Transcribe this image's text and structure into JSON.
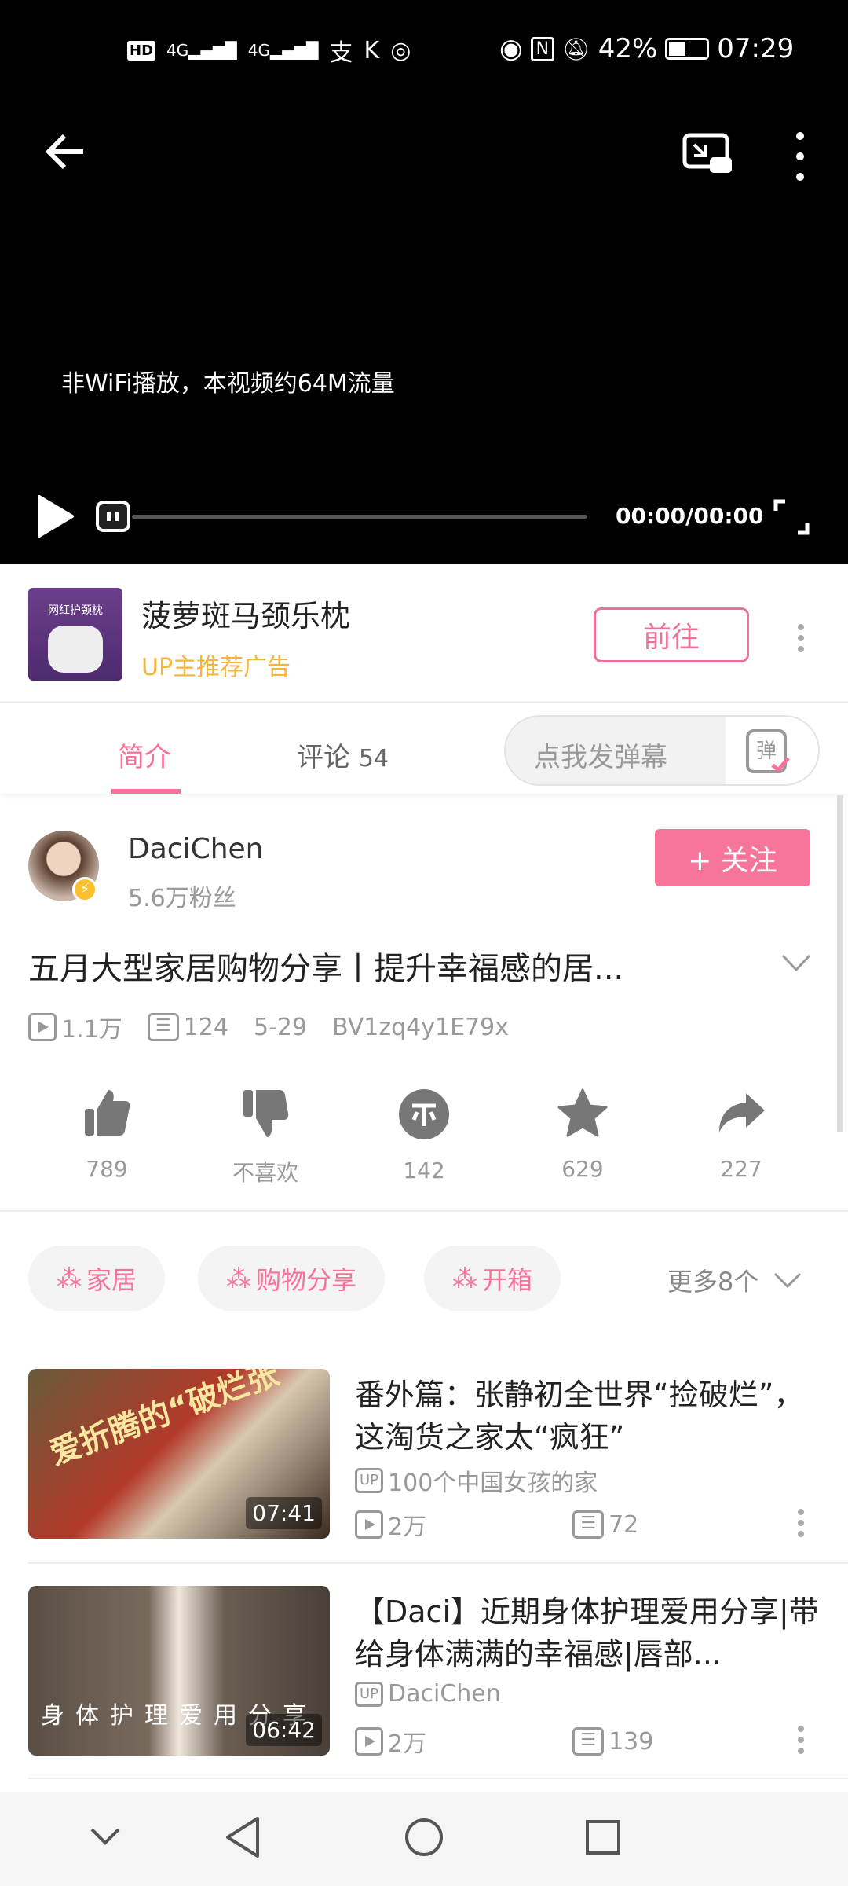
{
  "status_bar": {
    "left_icons": [
      "hd-icon",
      "4g-signal-icon",
      "4g-signal-icon",
      "alipay-icon",
      "k-icon",
      "location-icon"
    ],
    "battery": "42%",
    "time": "07:29",
    "battery_level": 0.42
  },
  "player": {
    "notice": "非WiFi播放，本视频约64M流量",
    "time": "00:00/00:00",
    "progress": 0
  },
  "ad": {
    "title": "菠萝斑马颈乐枕",
    "subtitle": "UP主推荐广告",
    "button": "前往",
    "thumb_text": "网红护颈枕"
  },
  "tabs": [
    {
      "label": "简介",
      "active": true
    },
    {
      "label": "评论",
      "count": "54"
    }
  ],
  "danmaku": {
    "placeholder": "点我发弹幕",
    "icon_text": "弹"
  },
  "uploader": {
    "name": "DaciChen",
    "fans": "5.6万粉丝",
    "follow": "+ 关注"
  },
  "video": {
    "title": "五月大型家居购物分享丨提升幸福感的居...",
    "views": "1.1万",
    "danmaku": "124",
    "date": "5-29",
    "bvid": "BV1zq4y1E79x"
  },
  "actions": [
    {
      "icon": "thumbs-up-icon",
      "label": "789"
    },
    {
      "icon": "thumbs-down-icon",
      "label": "不喜欢"
    },
    {
      "icon": "coin-icon",
      "label": "142"
    },
    {
      "icon": "star-icon",
      "label": "629"
    },
    {
      "icon": "share-icon",
      "label": "227"
    }
  ],
  "tags": [
    "家居",
    "购物分享",
    "开箱"
  ],
  "more_tags": "更多8个",
  "related": [
    {
      "title": "番外篇：张静初全世界“捡破烂”，这淘货之家太“疯狂”",
      "up": "100个中国女孩的家",
      "views": "2万",
      "danmaku": "72",
      "duration": "07:41",
      "thumb_text": "爱折腾的“破烂张”"
    },
    {
      "title": "【Daci】近期身体护理爱用分享|带给身体满满的幸福感|唇部...",
      "up": "DaciChen",
      "views": "2万",
      "danmaku": "139",
      "duration": "06:42",
      "thumb_text": "身体护理爱用分享"
    }
  ],
  "colors": {
    "accent": "#fb7299",
    "ad_label": "#f5b43c"
  }
}
